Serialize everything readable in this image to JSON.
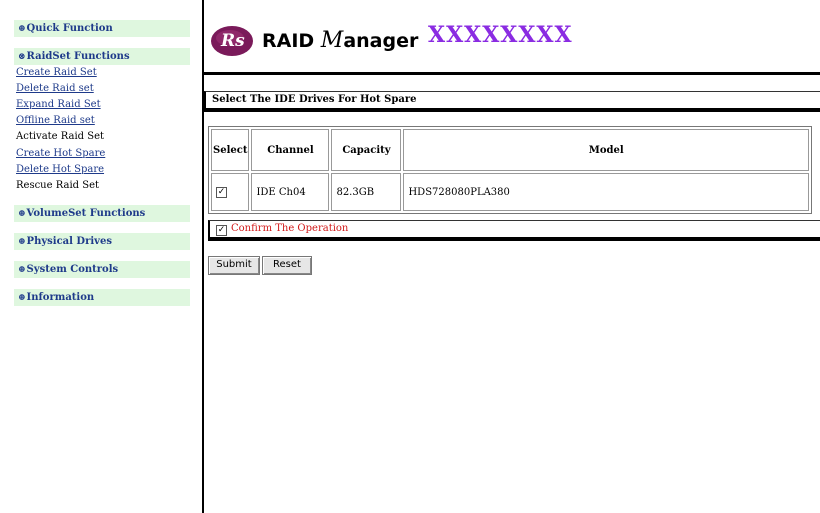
{
  "sidebar": {
    "sections": [
      {
        "label": "Quick Function",
        "glyph": "⊕"
      },
      {
        "label": "RaidSet Functions",
        "glyph": "⊗"
      },
      {
        "label": "VolumeSet Functions",
        "glyph": "⊕"
      },
      {
        "label": "Physical Drives",
        "glyph": "⊕"
      },
      {
        "label": "System Controls",
        "glyph": "⊕"
      },
      {
        "label": "Information",
        "glyph": "⊕"
      }
    ],
    "raidset_items": [
      {
        "label": "Create Raid Set"
      },
      {
        "label": "Delete Raid set"
      },
      {
        "label": "Expand Raid Set"
      },
      {
        "label": "Offline Raid set"
      },
      {
        "label": "Activate Raid Set"
      },
      {
        "label": "Create Hot Spare"
      },
      {
        "label": "Delete Hot Spare"
      },
      {
        "label": "Rescue Raid Set"
      }
    ]
  },
  "header": {
    "logo_text": "Rs",
    "title_prefix": "RAID ",
    "title_m": "M",
    "title_suffix": "anager",
    "product": "XXXXXXXX"
  },
  "colors": {
    "sidebar_head_bg": "#dff7df",
    "link": "#1e3a8a",
    "product": "#8a2be2",
    "confirm": "#d21b1b"
  },
  "panel": {
    "title": "Select The IDE Drives For Hot Spare",
    "columns": [
      "Select",
      "Channel",
      "Capacity",
      "Model"
    ],
    "rows": [
      {
        "selected": true,
        "channel": "IDE Ch04",
        "capacity": "82.3GB",
        "model": "HDS728080PLA380"
      }
    ],
    "confirm_label": "Confirm The Operation",
    "confirm_checked": true,
    "submit_label": "Submit",
    "reset_label": "Reset"
  }
}
